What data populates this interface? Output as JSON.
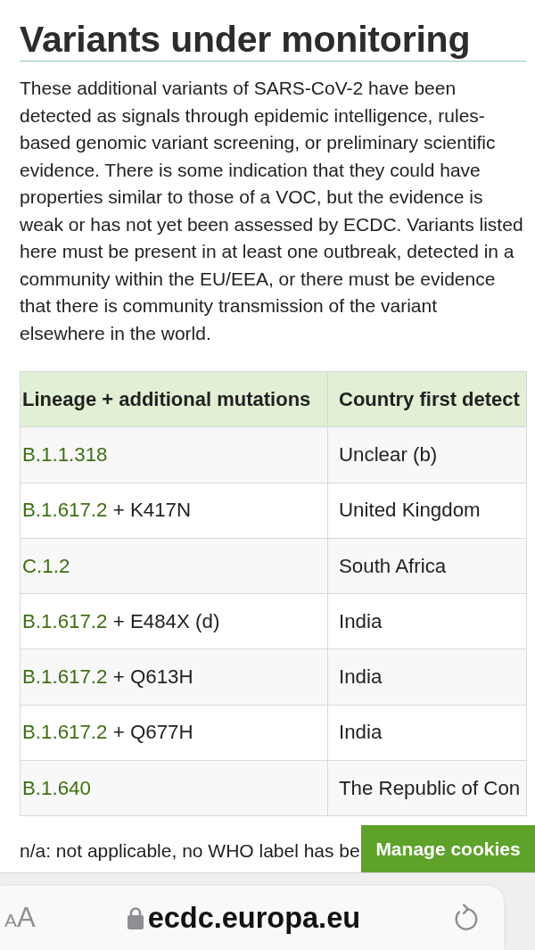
{
  "heading": "Variants under monitoring",
  "intro": "These additional variants of SARS-CoV-2 have been detected as signals through epidemic intelligence, rules-based genomic variant screening, or preliminary scientific evidence. There is some indication that they could have properties similar to those of a VOC, but the evidence is weak or has not yet been assessed by ECDC. Variants listed here must be present in at least one outbreak, detected in a community within the EU/EEA, or there must be evidence that there is community transmission of the variant elsewhere in the world.",
  "table": {
    "columns": [
      "Lineage + additional mutations",
      "Country first detect"
    ],
    "rows": [
      {
        "lineage": "B.1.1.318",
        "country": "Unclear (b)"
      },
      {
        "lineage": "B.1.617.2",
        "mutations": "+ K417N",
        "country": "United Kingdom"
      },
      {
        "lineage": "C.1.2",
        "country": "South Africa"
      },
      {
        "lineage": "B.1.617.2",
        "mutations": "+ E484X (d)",
        "country": "India"
      },
      {
        "lineage": "B.1.617.2",
        "mutations": "+ Q613H",
        "country": "India"
      },
      {
        "lineage": "B.1.617.2",
        "mutations": "+ Q677H",
        "country": "India"
      },
      {
        "lineage": "B.1.640",
        "country": "The Republic of Con"
      }
    ]
  },
  "note": "n/a: not applicable, no WHO label has be",
  "cookie_button": "Manage cookies",
  "browser_bar": {
    "text_size_button": {
      "small": "A",
      "large": "A"
    },
    "url": "ecdc.europa.eu"
  }
}
